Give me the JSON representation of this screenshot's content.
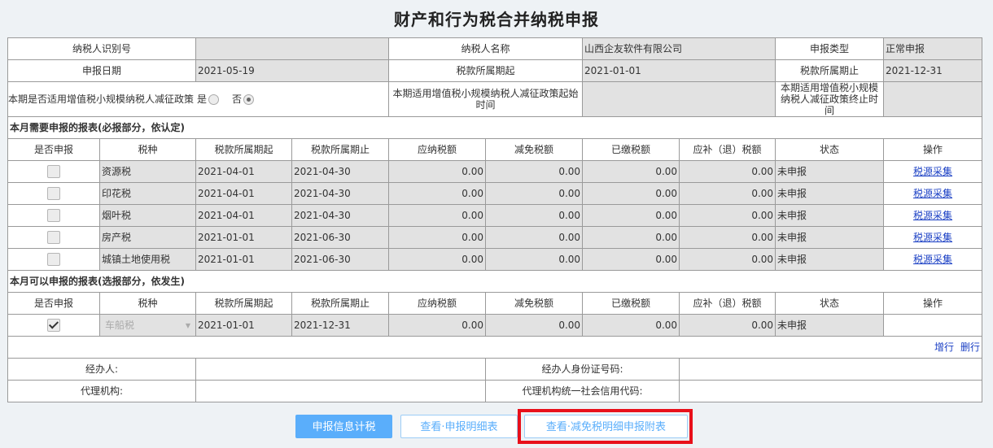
{
  "page": {
    "title": "财产和行为税合并纳税申报"
  },
  "header": {
    "taxpayer_id_label": "纳税人识别号",
    "taxpayer_id_value": "",
    "taxpayer_name_label": "纳税人名称",
    "taxpayer_name_value": "山西企友软件有限公司",
    "declare_type_label": "申报类型",
    "declare_type_value": "正常申报",
    "declare_date_label": "申报日期",
    "declare_date_value": "2021-05-19",
    "period_start_label": "税款所属期起",
    "period_start_value": "2021-01-01",
    "period_end_label": "税款所属期止",
    "period_end_value": "2021-12-31",
    "policy_label": "本期是否适用增值税小规模纳税人减征政策",
    "policy_yes": "是",
    "policy_no": "否",
    "policy_selected": "否",
    "policy_start_label": "本期适用增值税小规模纳税人减征政策起始时间",
    "policy_start_value": "",
    "policy_end_label": "本期适用增值税小规模纳税人减征政策终止时间",
    "policy_end_value": ""
  },
  "columns": [
    "是否申报",
    "税种",
    "税款所属期起",
    "税款所属期止",
    "应纳税额",
    "减免税额",
    "已缴税额",
    "应补（退）税额",
    "状态",
    "操作"
  ],
  "required": {
    "title": "本月需要申报的报表(必报部分，依认定)",
    "rows": [
      {
        "checked": false,
        "tax": "资源税",
        "start": "2021-04-01",
        "end": "2021-04-30",
        "due": "0.00",
        "relief": "0.00",
        "paid": "0.00",
        "diff": "0.00",
        "status": "未申报",
        "action": "税源采集"
      },
      {
        "checked": false,
        "tax": "印花税",
        "start": "2021-04-01",
        "end": "2021-04-30",
        "due": "0.00",
        "relief": "0.00",
        "paid": "0.00",
        "diff": "0.00",
        "status": "未申报",
        "action": "税源采集"
      },
      {
        "checked": false,
        "tax": "烟叶税",
        "start": "2021-04-01",
        "end": "2021-04-30",
        "due": "0.00",
        "relief": "0.00",
        "paid": "0.00",
        "diff": "0.00",
        "status": "未申报",
        "action": "税源采集"
      },
      {
        "checked": false,
        "tax": "房产税",
        "start": "2021-01-01",
        "end": "2021-06-30",
        "due": "0.00",
        "relief": "0.00",
        "paid": "0.00",
        "diff": "0.00",
        "status": "未申报",
        "action": "税源采集"
      },
      {
        "checked": false,
        "tax": "城镇土地使用税",
        "start": "2021-01-01",
        "end": "2021-06-30",
        "due": "0.00",
        "relief": "0.00",
        "paid": "0.00",
        "diff": "0.00",
        "status": "未申报",
        "action": "税源采集"
      }
    ]
  },
  "optional": {
    "title": "本月可以申报的报表(选报部分，依发生)",
    "rows": [
      {
        "checked": true,
        "tax": "车船税",
        "start": "2021-01-01",
        "end": "2021-12-31",
        "due": "0.00",
        "relief": "0.00",
        "paid": "0.00",
        "diff": "0.00",
        "status": "未申报",
        "action": ""
      }
    ],
    "add_row": "增行",
    "del_row": "删行"
  },
  "footer": {
    "agent_label": "经办人:",
    "agent_value": "",
    "agent_id_label": "经办人身份证号码:",
    "agent_id_value": "",
    "agency_label": "代理机构:",
    "agency_value": "",
    "agency_code_label": "代理机构统一社会信用代码:",
    "agency_code_value": ""
  },
  "buttons": {
    "calc": "申报信息计税",
    "view_detail": "查看·申报明细表",
    "view_relief": "查看·减免税明细申报附表"
  },
  "colors": {
    "primary": "#5aaefb",
    "highlight": "#e8101a",
    "link": "#1a3fc4"
  }
}
